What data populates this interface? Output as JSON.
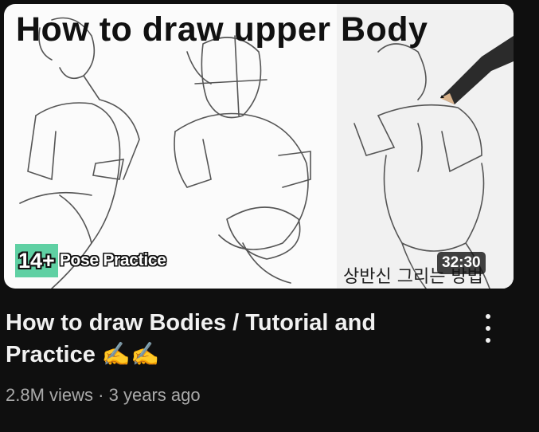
{
  "video": {
    "thumbnail": {
      "title": "How to draw upper Body",
      "badge_number": "14+",
      "badge_text": "Pose Practice",
      "korean_caption": "상반신 그리는 방법",
      "duration": "32:30"
    },
    "title": "How to draw Bodies / Tutorial and Practice ✍️✍️",
    "views": "2.8M views",
    "separator": "·",
    "age": "3 years ago",
    "menu_icon": "more-vertical-icon"
  }
}
